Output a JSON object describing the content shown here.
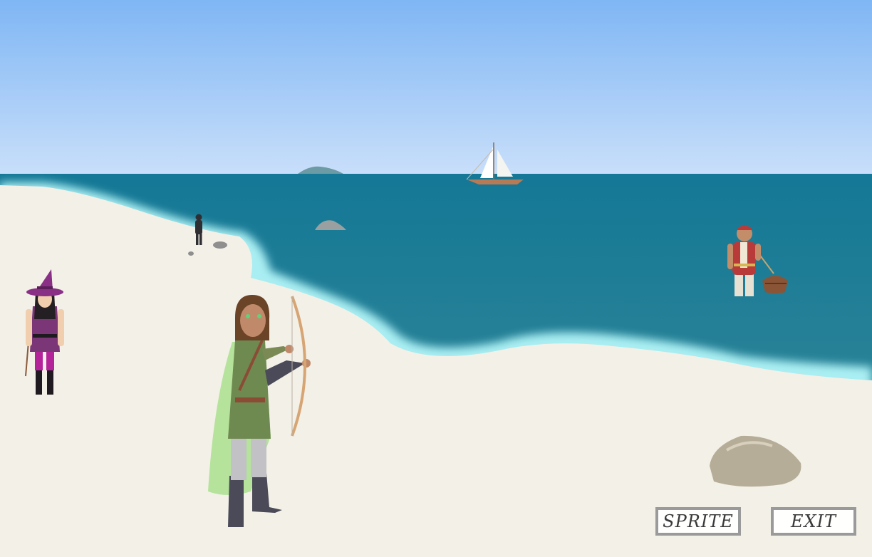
{
  "ui": {
    "sprite_label": "SPRITE",
    "exit_label": "EXIT"
  },
  "scene": {
    "sky_top": "#7fb6f4",
    "sky_bottom": "#c7defa",
    "sea_deep": "#177a96",
    "sea_mid": "#2b8299",
    "foam": "#a9eef2",
    "sand": "#f3f0e7",
    "characters": [
      "archer",
      "witch",
      "sailor",
      "distant-figure"
    ],
    "objects": [
      "sailboat",
      "island",
      "rowboat",
      "boulder",
      "rock"
    ]
  }
}
